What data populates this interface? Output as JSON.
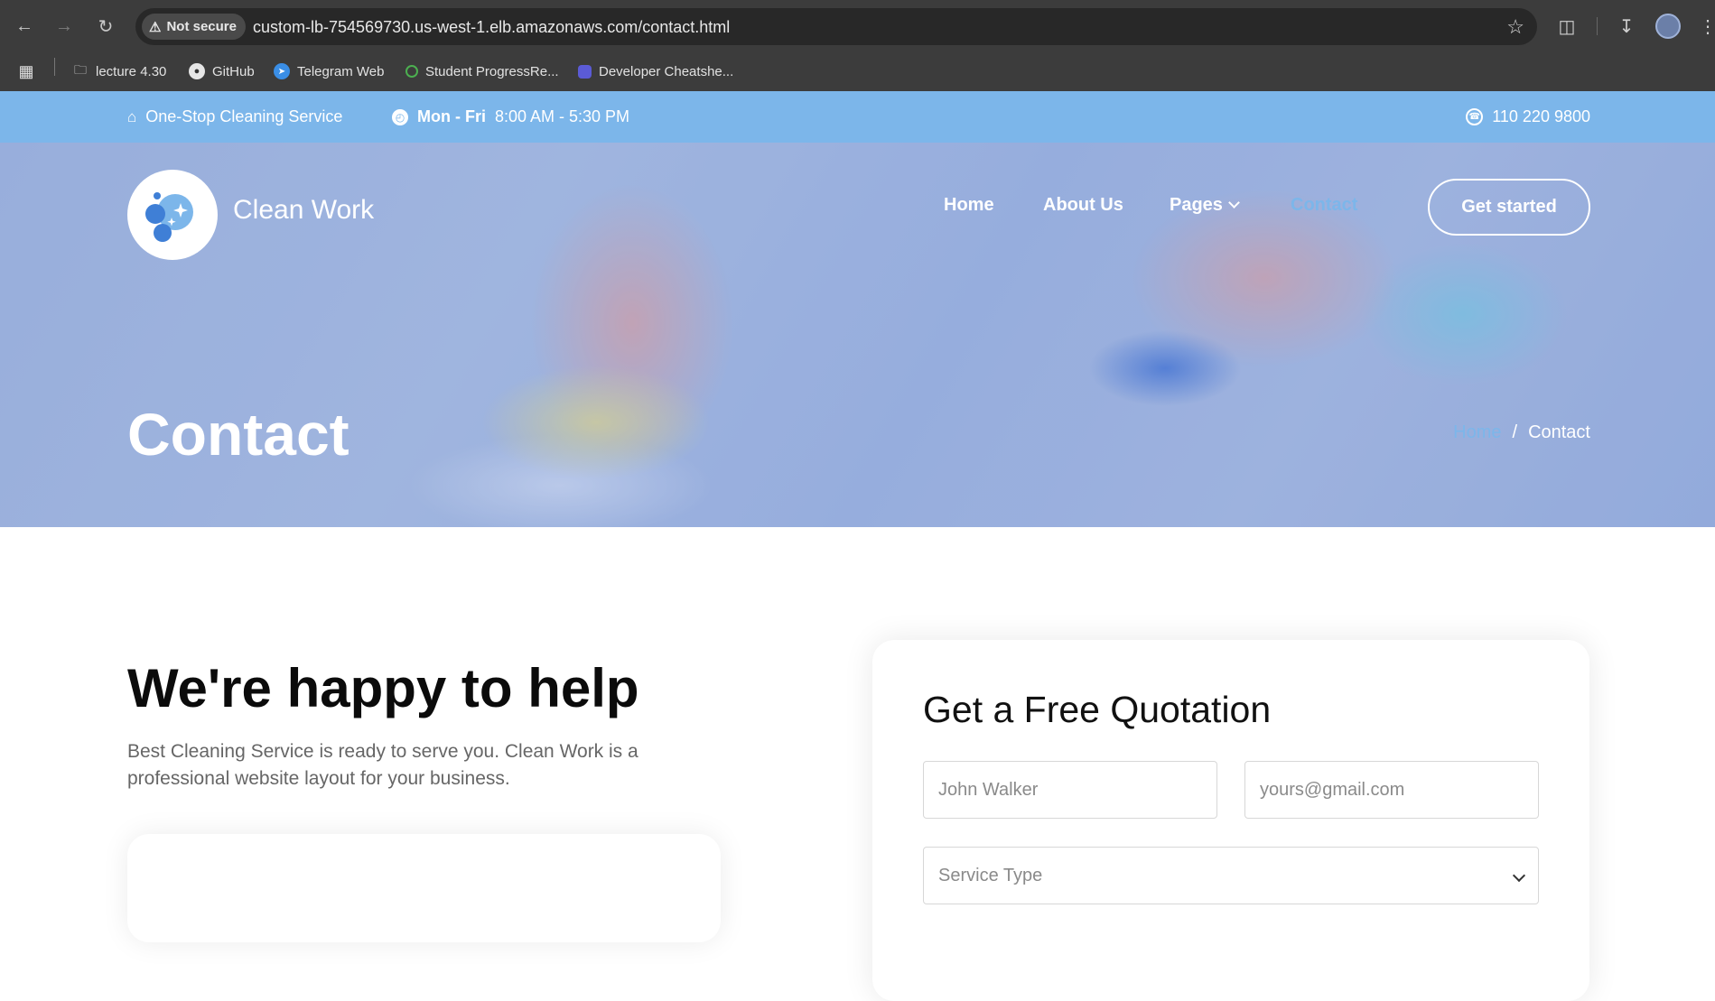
{
  "browser": {
    "security_label": "Not secure",
    "url": "custom-lb-754569730.us-west-1.elb.amazonaws.com/contact.html",
    "bookmarks": [
      {
        "label": "lecture 4.30",
        "icon": "folder-icon"
      },
      {
        "label": "GitHub",
        "icon": "github-icon"
      },
      {
        "label": "Telegram Web",
        "icon": "telegram-icon"
      },
      {
        "label": "Student ProgressRe...",
        "icon": "site-icon"
      },
      {
        "label": "Developer Cheatshe...",
        "icon": "site-icon"
      }
    ]
  },
  "topbar": {
    "service_text": "One-Stop Cleaning Service",
    "days": "Mon - Fri",
    "hours": "8:00 AM - 5:30 PM",
    "phone": "110 220 9800"
  },
  "header": {
    "brand": "Clean Work",
    "nav": [
      {
        "label": "Home",
        "active": false
      },
      {
        "label": "About Us",
        "active": false
      },
      {
        "label": "Pages",
        "active": false,
        "has_dropdown": true
      },
      {
        "label": "Contact",
        "active": true
      }
    ],
    "cta": "Get started"
  },
  "hero": {
    "title": "Contact",
    "breadcrumb": {
      "home": "Home",
      "separator": "/",
      "current": "Contact"
    }
  },
  "intro": {
    "heading": "We're happy to help",
    "text": "Best Cleaning Service is ready to serve you. Clean Work is a professional website layout for your business."
  },
  "quote_form": {
    "title": "Get a Free Quotation",
    "name_placeholder": "John Walker",
    "email_placeholder": "yours@gmail.com",
    "service_placeholder": "Service Type"
  },
  "colors": {
    "accent": "#7cb6ea",
    "chrome_bg": "#3c3c3c",
    "heading": "#0b0b0b"
  }
}
